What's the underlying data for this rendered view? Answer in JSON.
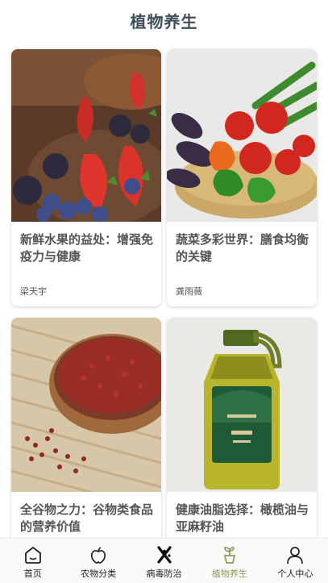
{
  "header": {
    "title": "植物养生"
  },
  "cards": [
    {
      "title": "新鲜水果的益处：增强免疫力与健康",
      "author": "梁天宇",
      "image": "berries-fruit-photo"
    },
    {
      "title": "蔬菜多彩世界：膳食均衡的关键",
      "author": "龚雨薇",
      "image": "vegetables-basket-photo"
    },
    {
      "title": "全谷物之力：谷物类食品的营养价值",
      "author": "",
      "image": "red-beans-bowl-photo"
    },
    {
      "title": "健康油脂选择：橄榄油与亚麻籽油",
      "author": "",
      "image": "olive-oil-bottle-photo"
    }
  ],
  "tabbar": {
    "items": [
      {
        "label": "首页",
        "icon": "home-icon"
      },
      {
        "label": "农物分类",
        "icon": "apple-icon"
      },
      {
        "label": "病毒防治",
        "icon": "virus-cross-icon"
      },
      {
        "label": "植物养生",
        "icon": "sprout-pot-icon",
        "active": true
      },
      {
        "label": "个人中心",
        "icon": "person-icon"
      }
    ]
  },
  "colors": {
    "title": "#3f4e5a",
    "active_tab": "#8a9a55"
  }
}
